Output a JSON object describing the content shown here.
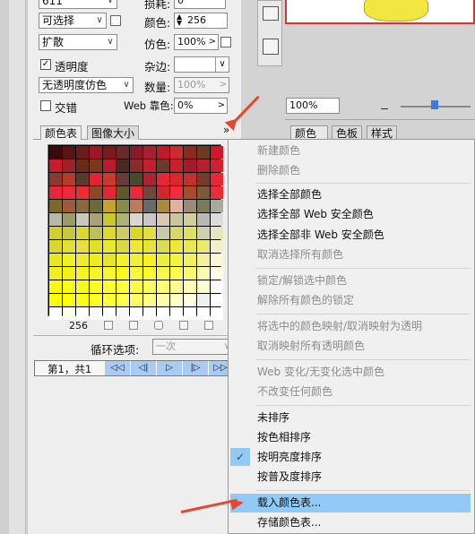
{
  "left_panel": {
    "row0": {
      "select_value": "611",
      "label": "损耗:",
      "value": "0"
    },
    "row1": {
      "select_value": "可选择",
      "label": "颜色:",
      "value": "256"
    },
    "row2": {
      "select_value": "扩散",
      "label": "仿色:",
      "value": "100%"
    },
    "row3": {
      "checkbox_label": "透明度",
      "checkbox_mark": "✓",
      "label": "杂边:"
    },
    "row4": {
      "select_value": "无透明度仿色",
      "label": "数量:",
      "value": "100%"
    },
    "row5": {
      "checkbox_label": "交错",
      "label": "Web 靠色:",
      "value": "0%"
    },
    "tabs": [
      "颜色表",
      "图像大小"
    ],
    "tab_more": "»",
    "color_count": "256",
    "loop_label": "循环选项:",
    "loop_value": "一次",
    "frame_label": "第1，共1",
    "nav": [
      "◁◁",
      "◁|",
      "▷",
      "|▷",
      "▷▷"
    ]
  },
  "colors": [
    [
      "#3a0a0a",
      "#5a1414",
      "#6b1c1c",
      "#a01626",
      "#7a1a1a",
      "#6a2a2a",
      "#8a1a2a",
      "#a82030",
      "#c01a2a",
      "#c82c2c",
      "#8a2a20",
      "#6a3c1c",
      "#d01828"
    ],
    [
      "#c81c2c",
      "#a02028",
      "#6a2a1a",
      "#7a3a1a",
      "#b81c2c",
      "#4a2a1a",
      "#8a2a2a",
      "#c02030",
      "#6a3a2a",
      "#c82030",
      "#a01c2c",
      "#b42030",
      "#cc2232"
    ],
    [
      "#8a3a2a",
      "#b83a2a",
      "#5a3a2a",
      "#e02436",
      "#c83a2a",
      "#6a3a3a",
      "#4a4a2a",
      "#a82232",
      "#e42636",
      "#d82a2a",
      "#c23032",
      "#7a3a2a",
      "#e82838"
    ],
    [
      "#e8283a",
      "#f02a3a",
      "#ec2a38",
      "#8a4a2a",
      "#e42838",
      "#5a5a2a",
      "#ea2a3a",
      "#6a4a3a",
      "#ce2a2e",
      "#f22c3c",
      "#aa4a2a",
      "#7a5a3a",
      "#e82c3a"
    ],
    [
      "#7a6a2a",
      "#a05a3a",
      "#8a6a3a",
      "#6a6a3a",
      "#c8a02a",
      "#8a8a4a",
      "#c07a5a",
      "#6a6a6a",
      "#aa8a3a",
      "#e4b0a0",
      "#9a8a7a",
      "#7a7a5a",
      "#aaaa9a"
    ],
    [
      "#b8b8a8",
      "#9a9a6a",
      "#c8c8c0",
      "#aaa07a",
      "#c8c830",
      "#b0b07a",
      "#d8d8d0",
      "#c8c8c8",
      "#d8c8b8",
      "#c8c89a",
      "#d0d09a",
      "#b8b8b8",
      "#dcdcdc"
    ],
    [
      "#d0d030",
      "#c8c840",
      "#d8d838",
      "#c0c05a",
      "#e0d830",
      "#cccc6a",
      "#d8d830",
      "#e0e040",
      "#c8c8aa",
      "#d8d86a",
      "#e0e060",
      "#d0d0b0",
      "#e6e6c0"
    ],
    [
      "#d8d830",
      "#e0e038",
      "#e8e040",
      "#e0e028",
      "#e8e830",
      "#d8d848",
      "#ece838",
      "#e4e440",
      "#dcdc50",
      "#f0e838",
      "#e8e850",
      "#eaea70",
      "#f0f0c8"
    ],
    [
      "#e8e820",
      "#f0f028",
      "#ecec30",
      "#f0ec20",
      "#e6e628",
      "#f4f030",
      "#f0f038",
      "#f8f028",
      "#eeee40",
      "#f4f440",
      "#f0f060",
      "#f4f0a0",
      "#f8f8d8"
    ],
    [
      "#f0f020",
      "#f4f018",
      "#f8f420",
      "#f4f428",
      "#f8f830",
      "#fcf820",
      "#f8f838",
      "#fafa30",
      "#f8f848",
      "#fcfc50",
      "#f8f870",
      "#fafab0",
      "#fcfce8"
    ],
    [
      "#f8f810",
      "#fcfc18",
      "#fafa20",
      "#fcfc28",
      "#fefe30",
      "#fcfc40",
      "#fefe48",
      "#fcfc60",
      "#fefe70",
      "#fcfc90",
      "#fefeb0",
      "#fdfdd0",
      "#ffffff"
    ],
    [
      "#fcfc08",
      "#fefe10",
      "#fcfc18",
      "#fefe28",
      "#ffff38",
      "#fefe50",
      "#ffff68",
      "#fefe88",
      "#ffffa8",
      "#fefec8",
      "#ffffe0",
      "#f0f0f0",
      "#ffffff"
    ],
    [
      "#ffffff",
      "#fefef0",
      "#ffffff",
      "#fafafa",
      "#ffffff",
      "#f8f8f8",
      "#ffffff",
      "#fcfcfc",
      "#ffffff",
      "#fefefe",
      "#ffffff",
      "#fdfdfd",
      "#ffffff"
    ]
  ],
  "right": {
    "zoom": "100%",
    "tabs": [
      "颜色 ×",
      "色板",
      "样式"
    ]
  },
  "menu": {
    "items": [
      {
        "label": "新建颜色",
        "disabled": true
      },
      {
        "label": "删除颜色",
        "disabled": true
      },
      {
        "label": "选择全部颜色",
        "disabled": false
      },
      {
        "label": "选择全部 Web 安全颜色",
        "disabled": false
      },
      {
        "label": "选择全部非 Web 安全颜色",
        "disabled": false
      },
      {
        "label": "取消选择所有颜色",
        "disabled": true
      },
      {
        "label": "锁定/解锁选中颜色",
        "disabled": true
      },
      {
        "label": "解除所有颜色的锁定",
        "disabled": true
      },
      {
        "label": "将选中的颜色映射/取消映射为透明",
        "disabled": true
      },
      {
        "label": "取消映射所有透明颜色",
        "disabled": true
      },
      {
        "label": "Web 变化/无变化选中颜色",
        "disabled": true
      },
      {
        "label": "不改变任何颜色",
        "disabled": true
      },
      {
        "label": "未排序",
        "disabled": false
      },
      {
        "label": "按色相排序",
        "disabled": false
      },
      {
        "label": "按明亮度排序",
        "disabled": false,
        "checked": true
      },
      {
        "label": "按普及度排序",
        "disabled": false
      },
      {
        "label": "载入颜色表...",
        "disabled": false,
        "highlighted": true
      },
      {
        "label": "存储颜色表...",
        "disabled": false
      }
    ],
    "check_mark": "✓"
  }
}
